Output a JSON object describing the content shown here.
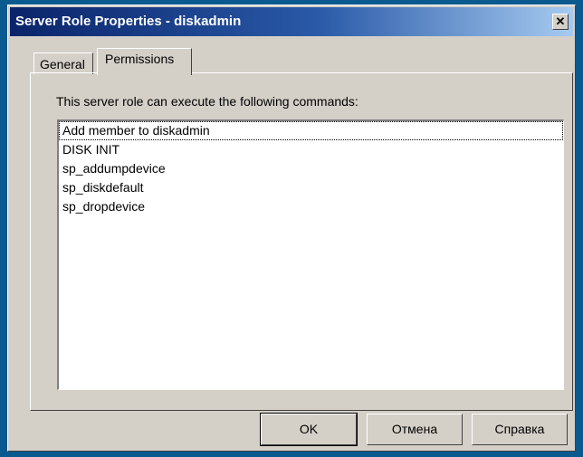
{
  "window": {
    "title": "Server Role Properties - diskadmin",
    "close_glyph": "✕"
  },
  "tabs": [
    {
      "label": "General",
      "active": false
    },
    {
      "label": "Permissions",
      "active": true
    }
  ],
  "permissions": {
    "description": "This server role can execute the following commands:",
    "commands": [
      "Add member to diskadmin",
      "DISK INIT",
      "sp_addumpdevice",
      "sp_diskdefault",
      "sp_dropdevice"
    ]
  },
  "buttons": {
    "ok": "OK",
    "cancel": "Отмена",
    "help": "Справка"
  },
  "colors": {
    "desktop": "#0b5a8f",
    "dialog_face": "#d4d0c8",
    "titlebar_start": "#0a246a",
    "titlebar_end": "#a6caf0"
  }
}
